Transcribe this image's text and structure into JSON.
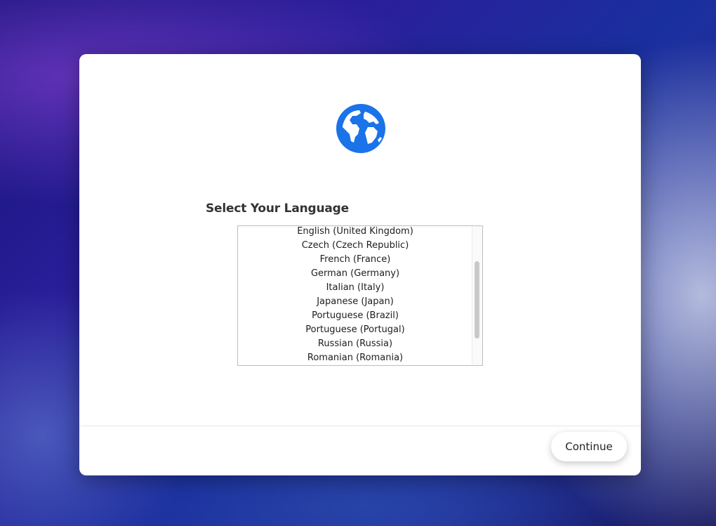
{
  "dialog": {
    "icon": "globe-icon",
    "title": "Select Your Language",
    "languages": [
      "English (United Kingdom)",
      "Czech (Czech Republic)",
      "French (France)",
      "German (Germany)",
      "Italian (Italy)",
      "Japanese (Japan)",
      "Portuguese (Brazil)",
      "Portuguese (Portugal)",
      "Russian (Russia)",
      "Romanian (Romania)"
    ],
    "continue_label": "Continue"
  },
  "colors": {
    "globe": "#1a73e8",
    "dialog_bg": "#ffffff"
  }
}
